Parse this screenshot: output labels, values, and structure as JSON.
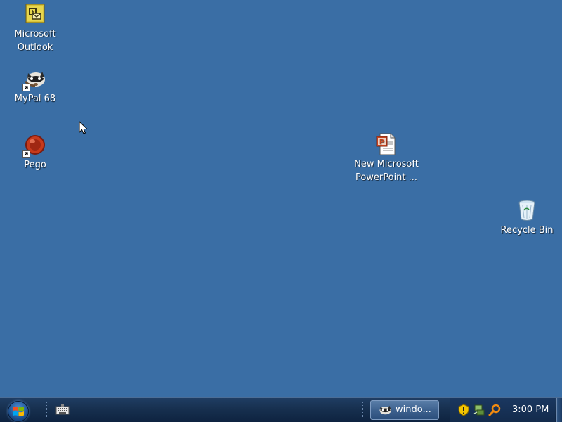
{
  "desktop": {
    "background": "#3a6ea5",
    "icons": [
      {
        "name": "outlook",
        "label": "Microsoft\nOutlook",
        "icon": "outlook-icon"
      },
      {
        "name": "mypal",
        "label": "MyPal 68",
        "icon": "raccoon-icon"
      },
      {
        "name": "pego",
        "label": "Pego",
        "icon": "pego-icon"
      },
      {
        "name": "powerpoint",
        "label": "New Microsoft\nPowerPoint ...",
        "icon": "powerpoint-document-icon"
      },
      {
        "name": "recycle-bin",
        "label": "Recycle Bin",
        "icon": "recycle-bin-icon"
      }
    ]
  },
  "taskbar": {
    "start_icon": "windows-start-orb",
    "quick_launch": [
      {
        "icon": "keyboard-icon"
      }
    ],
    "tasks": [
      {
        "label": "windo...",
        "icon": "raccoon-icon"
      }
    ],
    "tray": {
      "icons": [
        "security-shield-icon",
        "network-icon",
        "search-icon"
      ],
      "clock": "3:00 PM"
    }
  }
}
